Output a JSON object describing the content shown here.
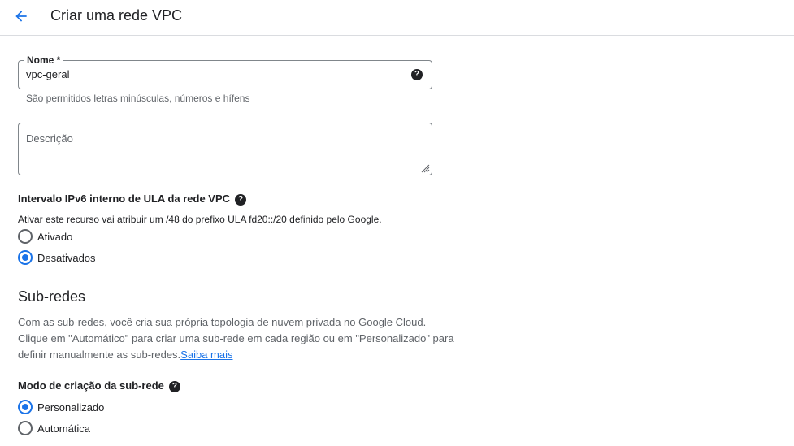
{
  "header": {
    "title": "Criar uma rede VPC"
  },
  "name_field": {
    "label": "Nome *",
    "value": "vpc-geral",
    "hint": "São permitidos letras minúsculas, números e hífens",
    "help_icon": "help-icon"
  },
  "description_field": {
    "placeholder": "Descrição"
  },
  "ipv6": {
    "label": "Intervalo IPv6 interno de ULA da rede VPC",
    "description": "Ativar este recurso vai atribuir um /48 do prefixo ULA fd20::/20 definido pelo Google.",
    "options": [
      {
        "label": "Ativado",
        "checked": false
      },
      {
        "label": "Desativados",
        "checked": true
      }
    ]
  },
  "subnets": {
    "title": "Sub-redes",
    "paragraph": "Com as sub-redes, você cria sua própria topologia de nuvem privada no Google Cloud. Clique em \"Automático\" para criar uma sub-rede em cada região ou em \"Personalizado\" para definir manualmente as sub-redes.",
    "link": "Saiba mais",
    "mode_label": "Modo de criação da sub-rede",
    "options": [
      {
        "label": "Personalizado",
        "checked": true
      },
      {
        "label": "Automática",
        "checked": false
      }
    ]
  },
  "colors": {
    "accent": "#1a73e8",
    "text": "#202124",
    "muted": "#5f6368",
    "border": "#80868b"
  }
}
